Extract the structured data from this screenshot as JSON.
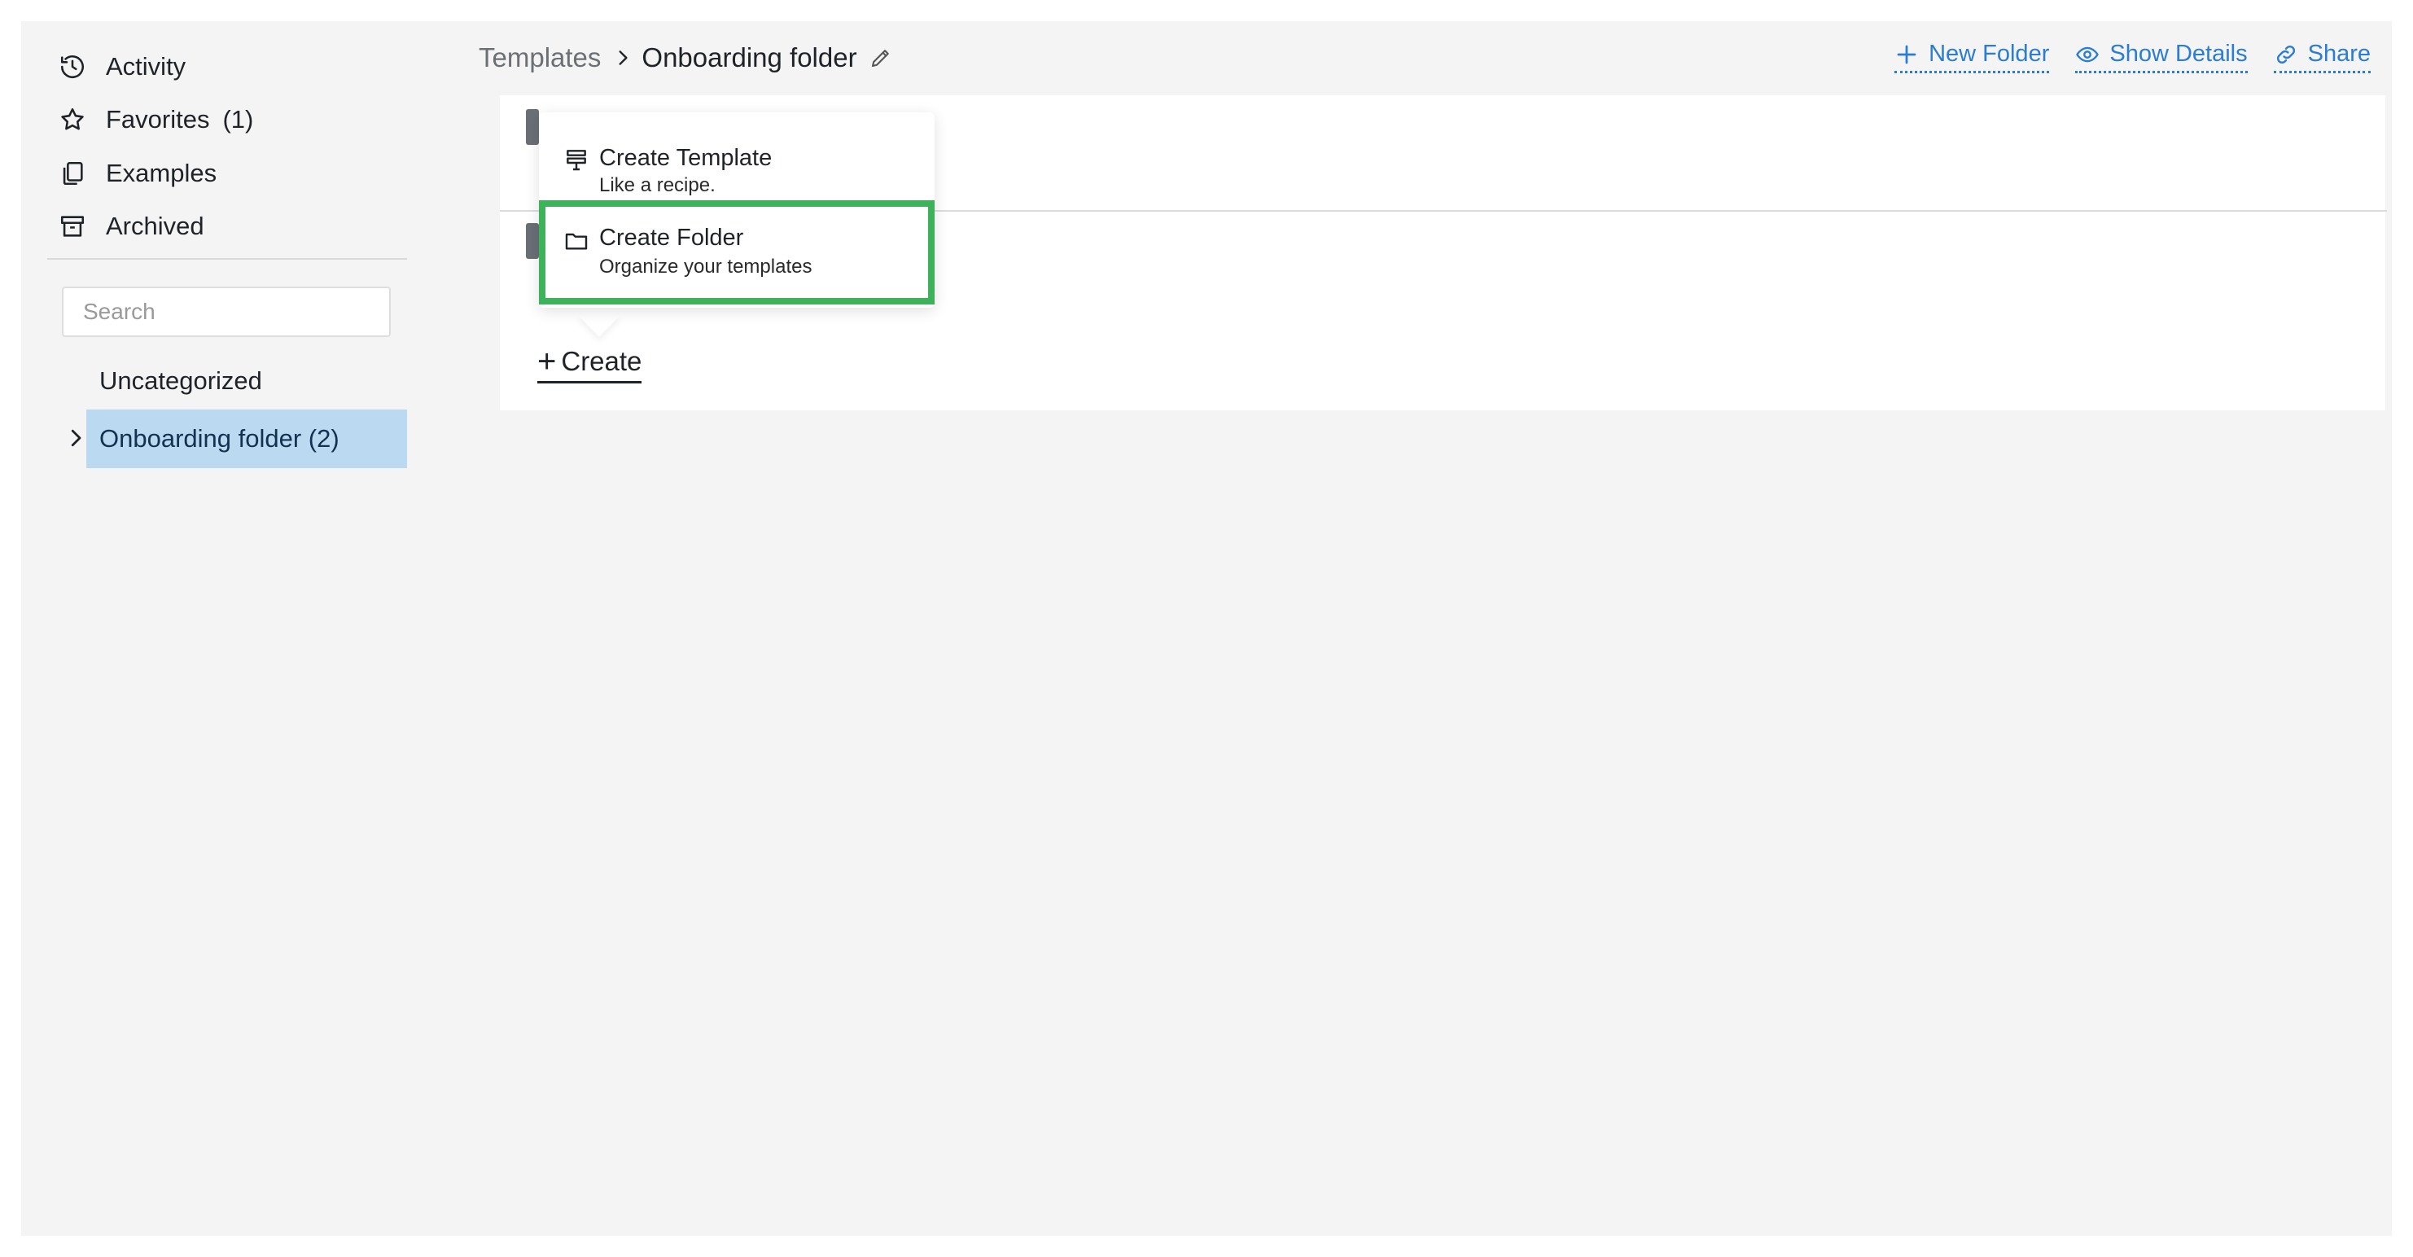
{
  "sidebar": {
    "nav": [
      {
        "label": "Activity",
        "icon": "history-icon"
      },
      {
        "label": "Favorites",
        "count": "(1)",
        "icon": "star-icon"
      },
      {
        "label": "Examples",
        "icon": "copy-icon"
      },
      {
        "label": "Archived",
        "icon": "archive-icon"
      }
    ],
    "search_placeholder": "Search",
    "categories": [
      "Uncategorized"
    ],
    "selected_folder": "Onboarding folder (2)"
  },
  "header": {
    "breadcrumb_root": "Templates",
    "breadcrumb_current": "Onboarding folder",
    "actions": {
      "new_folder": "New Folder",
      "show_details": "Show Details",
      "share": "Share"
    }
  },
  "create_menu": {
    "items": [
      {
        "title": "Create Template",
        "subtitle": "Like a recipe.",
        "icon": "template-icon"
      },
      {
        "title": "Create Folder",
        "subtitle": "Organize your templates",
        "icon": "folder-icon",
        "highlighted": true
      }
    ],
    "create_label": "Create"
  },
  "colors": {
    "accent": "#2b7cd3",
    "selected_bg": "#bcd9f2",
    "highlight": "#3db25a",
    "page_bg": "#f4f4f4"
  }
}
